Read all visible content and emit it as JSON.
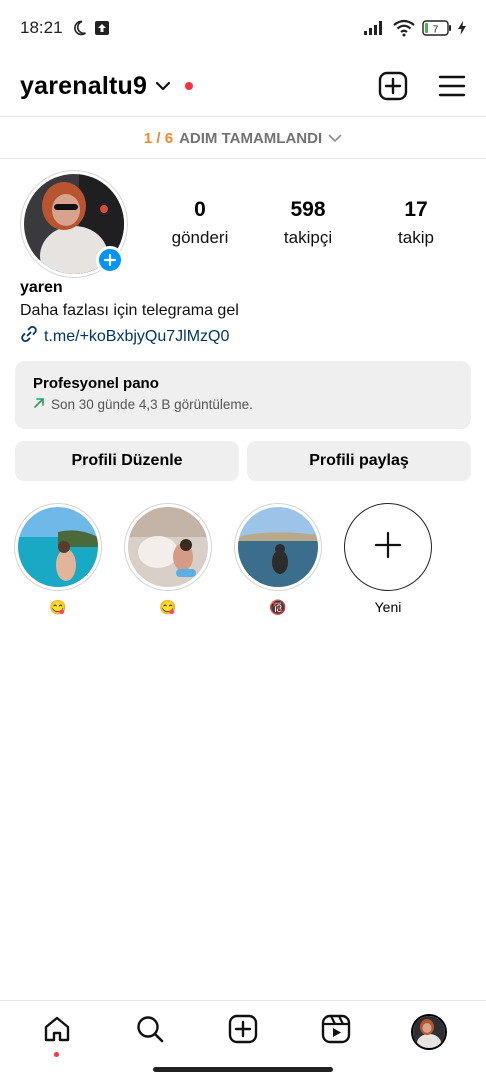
{
  "status_bar": {
    "time": "18:21",
    "battery": "7",
    "icons": [
      "moon-icon",
      "upload-icon",
      "signal-icon",
      "wifi-icon",
      "battery-icon",
      "charging-icon"
    ]
  },
  "header": {
    "username": "yarenaltu9",
    "icons": [
      "chevron-down-icon",
      "new-post-icon",
      "menu-icon"
    ]
  },
  "progress": {
    "count": "1 / 6",
    "label": "ADIM TAMAMLANDI"
  },
  "profile": {
    "stats": [
      {
        "value": "0",
        "label": "gönderi"
      },
      {
        "value": "598",
        "label": "takipçi"
      },
      {
        "value": "17",
        "label": "takip"
      }
    ],
    "name": "yaren",
    "bio": "Daha fazlası için telegrama gel",
    "link": "t.me/+koBxbjyQu7JlMzQ0"
  },
  "dashboard": {
    "title": "Profesyonel pano",
    "subtitle": "Son 30 günde 4,3 B görüntüleme."
  },
  "buttons": {
    "edit": "Profili Düzenle",
    "share": "Profili paylaş"
  },
  "highlights": [
    {
      "label": "😋"
    },
    {
      "label": "😋"
    },
    {
      "label": "🔞"
    },
    {
      "label": "Yeni"
    }
  ],
  "colors": {
    "accent_blue": "#0095f6",
    "link": "#00376b",
    "progress_orange": "#f0882a",
    "notification_red": "#ff3040"
  }
}
